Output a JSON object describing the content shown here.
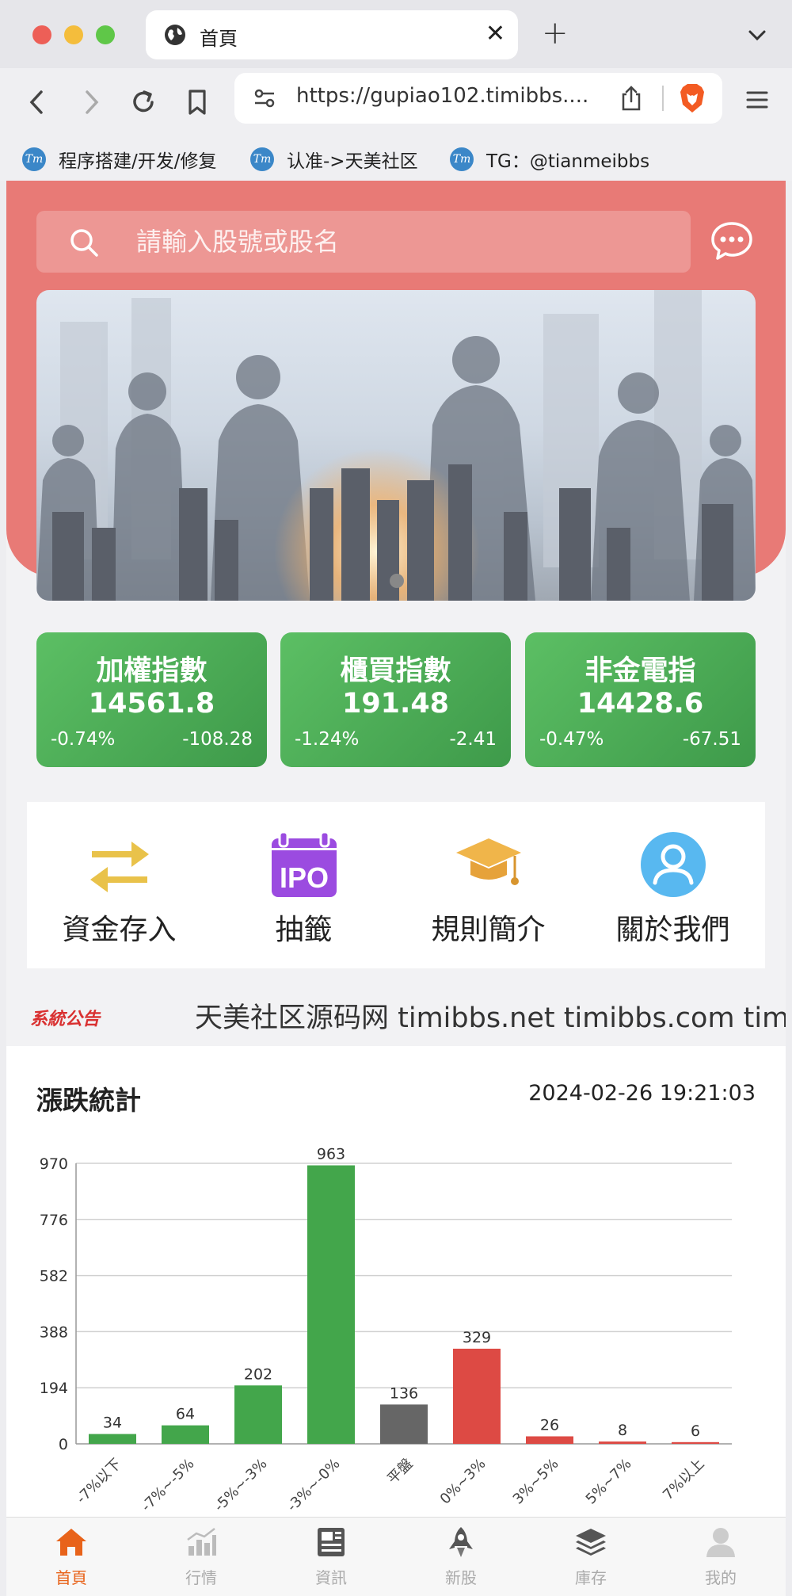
{
  "browser": {
    "tab_title": "首頁",
    "url": "https://gupiao102.timibbs....",
    "bookmarks": [
      {
        "icon_text": "Tm",
        "label": "程序搭建/开发/修复"
      },
      {
        "icon_text": "Tm",
        "label": "认准->天美社区"
      },
      {
        "icon_text": "Tm",
        "label": "TG：@tianmeibbs"
      }
    ]
  },
  "search": {
    "placeholder": "請輸入股號或股名"
  },
  "indices": [
    {
      "name": "加權指數",
      "value": "14561.8",
      "pct": "-0.74%",
      "change": "-108.28"
    },
    {
      "name": "櫃買指數",
      "value": "191.48",
      "pct": "-1.24%",
      "change": "-2.41"
    },
    {
      "name": "非金電指",
      "value": "14428.6",
      "pct": "-0.47%",
      "change": "-67.51"
    }
  ],
  "menu": [
    {
      "label": "資金存入",
      "icon": "transfer-arrows-icon"
    },
    {
      "label": "抽籤",
      "icon": "ipo-calendar-icon"
    },
    {
      "label": "規則簡介",
      "icon": "graduation-cap-icon"
    },
    {
      "label": "關於我們",
      "icon": "user-avatar-icon"
    }
  ],
  "notice": {
    "tag": "系統公告",
    "text": "天美社区源码网 timibbs.net timibbs.com timibbs.cc"
  },
  "stats": {
    "title": "漲跌統計",
    "timestamp": "2024-02-26 19:21:03"
  },
  "chart_data": {
    "type": "bar",
    "title": "",
    "categories": [
      "-7%以下",
      "-7%~-5%",
      "-5%~-3%",
      "-3%~-0%",
      "平盤",
      "0%~3%",
      "3%~5%",
      "5%~7%",
      "7%以上"
    ],
    "values": [
      34,
      64,
      202,
      963,
      136,
      329,
      26,
      8,
      6
    ],
    "bar_colors": [
      "#43a64b",
      "#43a64b",
      "#43a64b",
      "#43a64b",
      "#666666",
      "#dd4a44",
      "#dd4a44",
      "#dd4a44",
      "#dd4a44"
    ],
    "yticks": [
      0,
      194,
      388,
      582,
      776,
      970
    ],
    "ylim": [
      0,
      970
    ],
    "grid": true
  },
  "bottom_nav": [
    {
      "label": "首頁",
      "active": true
    },
    {
      "label": "行情",
      "active": false
    },
    {
      "label": "資訊",
      "active": false
    },
    {
      "label": "新股",
      "active": false
    },
    {
      "label": "庫存",
      "active": false
    },
    {
      "label": "我的",
      "active": false
    }
  ],
  "colors": {
    "brand": "#e87a76",
    "up": "#dd4a44",
    "down": "#43a64b",
    "flat": "#666666",
    "active_nav": "#e8631a"
  }
}
